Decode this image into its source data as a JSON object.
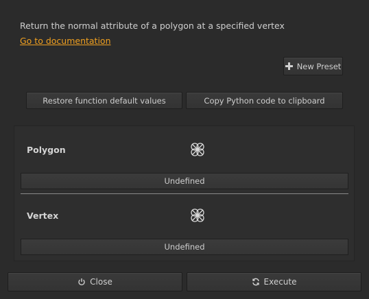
{
  "description": "Return the normal attribute of a polygon at a specified vertex",
  "documentation_link": "Go to documentation",
  "presets": {
    "new_preset_label": "New Preset"
  },
  "actions": {
    "restore_label": "Restore function default values",
    "copy_label": "Copy Python code to clipboard"
  },
  "parameters": [
    {
      "label": "Polygon",
      "value": "Undefined",
      "icon": "node-picker-icon"
    },
    {
      "label": "Vertex",
      "value": "Undefined",
      "icon": "node-picker-icon"
    }
  ],
  "footer": {
    "close_label": "Close",
    "execute_label": "Execute"
  },
  "colors": {
    "background": "#2b2b2b",
    "link": "#f0a020",
    "text": "#c8c8c8"
  }
}
